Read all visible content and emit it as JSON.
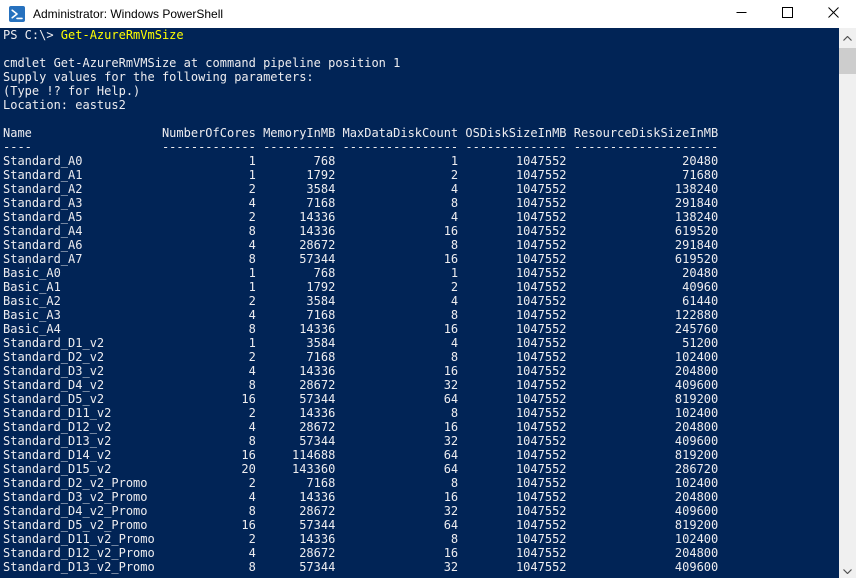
{
  "window": {
    "title": "Administrator: Windows PowerShell"
  },
  "icons": {
    "titlebar_app": "powershell-icon",
    "minimize": "minimize-icon",
    "maximize": "maximize-icon",
    "close": "close-icon",
    "scroll_up": "chevron-up-icon",
    "scroll_down": "chevron-down-icon"
  },
  "colors": {
    "console_background": "#012456",
    "console_foreground": "#EEEDF0",
    "command_text": "#FFFF00",
    "titlebar_background": "#FFFFFF",
    "titlebar_text": "#000000",
    "scrollbar_track": "#F0F0F0",
    "scrollbar_thumb": "#CDCDCD",
    "powershell_icon_blue": "#2671BE"
  },
  "console": {
    "prompt": "PS C:\\> ",
    "command": "Get-AzureRmVmSize",
    "messages": [
      "cmdlet Get-AzureRmVMSize at command pipeline position 1",
      "Supply values for the following parameters:",
      "(Type !? for Help.)",
      "Location: eastus2"
    ]
  },
  "table": {
    "columns": [
      "Name",
      "NumberOfCores",
      "MemoryInMB",
      "MaxDataDiskCount",
      "OSDiskSizeInMB",
      "ResourceDiskSizeInMB"
    ],
    "rows": [
      [
        "Standard_A0",
        1,
        768,
        1,
        1047552,
        20480
      ],
      [
        "Standard_A1",
        1,
        1792,
        2,
        1047552,
        71680
      ],
      [
        "Standard_A2",
        2,
        3584,
        4,
        1047552,
        138240
      ],
      [
        "Standard_A3",
        4,
        7168,
        8,
        1047552,
        291840
      ],
      [
        "Standard_A5",
        2,
        14336,
        4,
        1047552,
        138240
      ],
      [
        "Standard_A4",
        8,
        14336,
        16,
        1047552,
        619520
      ],
      [
        "Standard_A6",
        4,
        28672,
        8,
        1047552,
        291840
      ],
      [
        "Standard_A7",
        8,
        57344,
        16,
        1047552,
        619520
      ],
      [
        "Basic_A0",
        1,
        768,
        1,
        1047552,
        20480
      ],
      [
        "Basic_A1",
        1,
        1792,
        2,
        1047552,
        40960
      ],
      [
        "Basic_A2",
        2,
        3584,
        4,
        1047552,
        61440
      ],
      [
        "Basic_A3",
        4,
        7168,
        8,
        1047552,
        122880
      ],
      [
        "Basic_A4",
        8,
        14336,
        16,
        1047552,
        245760
      ],
      [
        "Standard_D1_v2",
        1,
        3584,
        4,
        1047552,
        51200
      ],
      [
        "Standard_D2_v2",
        2,
        7168,
        8,
        1047552,
        102400
      ],
      [
        "Standard_D3_v2",
        4,
        14336,
        16,
        1047552,
        204800
      ],
      [
        "Standard_D4_v2",
        8,
        28672,
        32,
        1047552,
        409600
      ],
      [
        "Standard_D5_v2",
        16,
        57344,
        64,
        1047552,
        819200
      ],
      [
        "Standard_D11_v2",
        2,
        14336,
        8,
        1047552,
        102400
      ],
      [
        "Standard_D12_v2",
        4,
        28672,
        16,
        1047552,
        204800
      ],
      [
        "Standard_D13_v2",
        8,
        57344,
        32,
        1047552,
        409600
      ],
      [
        "Standard_D14_v2",
        16,
        114688,
        64,
        1047552,
        819200
      ],
      [
        "Standard_D15_v2",
        20,
        143360,
        64,
        1047552,
        286720
      ],
      [
        "Standard_D2_v2_Promo",
        2,
        7168,
        8,
        1047552,
        102400
      ],
      [
        "Standard_D3_v2_Promo",
        4,
        14336,
        16,
        1047552,
        204800
      ],
      [
        "Standard_D4_v2_Promo",
        8,
        28672,
        32,
        1047552,
        409600
      ],
      [
        "Standard_D5_v2_Promo",
        16,
        57344,
        64,
        1047552,
        819200
      ],
      [
        "Standard_D11_v2_Promo",
        2,
        14336,
        8,
        1047552,
        102400
      ],
      [
        "Standard_D12_v2_Promo",
        4,
        28672,
        16,
        1047552,
        204800
      ],
      [
        "Standard_D13_v2_Promo",
        8,
        57344,
        32,
        1047552,
        409600
      ]
    ]
  }
}
